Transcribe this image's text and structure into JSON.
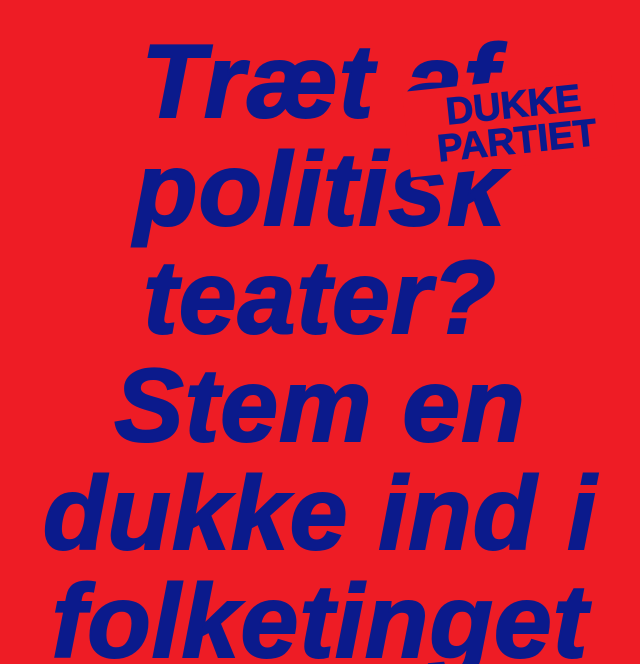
{
  "poster": {
    "background_color": "#ee1c25",
    "text_color": "#0b1a8c",
    "headline_lines": [
      "Træt af",
      "politisk",
      "teater?",
      "Stem en",
      "dukke ind i",
      "folketinget"
    ],
    "logo": {
      "line1": "DUKKE",
      "line2": "PARTIET"
    }
  }
}
